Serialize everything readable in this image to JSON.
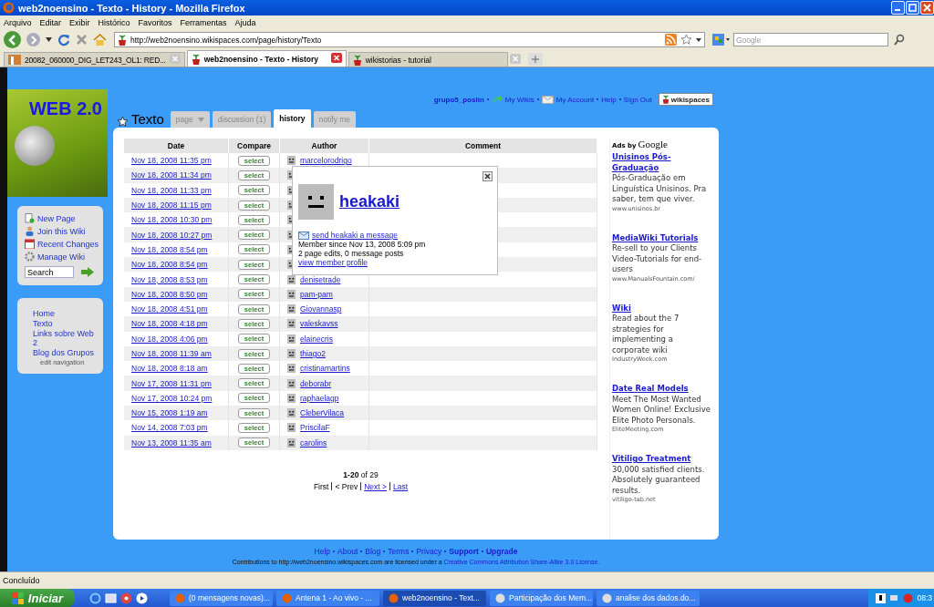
{
  "window": {
    "title": "web2noensino - Texto - History - Mozilla Firefox"
  },
  "menu": [
    "Arquivo",
    "Editar",
    "Exibir",
    "Histórico",
    "Favoritos",
    "Ferramentas",
    "Ajuda"
  ],
  "address": {
    "value": "http://web2noensino.wikispaces.com/page/history/Texto"
  },
  "search_engine": {
    "placeholder": "Google"
  },
  "browser_tabs": [
    {
      "label": "20082_060000_DIG_LET243_OL1: RED...",
      "selected": false
    },
    {
      "label": "web2noensino - Texto - History",
      "selected": true
    },
    {
      "label": "wikistorias - tutorial",
      "selected": false
    }
  ],
  "site": {
    "logo_text": "WEB 2.0",
    "user_links": [
      {
        "label": "grupo5_poslin",
        "bold": true
      },
      {
        "label": "My Wikis",
        "bold": false
      },
      {
        "label": "My Account",
        "bold": false
      },
      {
        "label": "Help",
        "bold": false
      },
      {
        "label": "Sign Out",
        "bold": false
      }
    ],
    "brand": "wikispaces"
  },
  "actions": [
    "New Page",
    "Join this Wiki",
    "Recent Changes",
    "Manage Wiki"
  ],
  "search": {
    "placeholder": "Search"
  },
  "navigation": {
    "items": [
      "Home",
      "Texto",
      "Links sobre Web 2",
      "Blog dos Grupos"
    ],
    "edit": "edit navigation"
  },
  "page": {
    "title": "Texto",
    "tabs": [
      {
        "label": "page",
        "selected": false
      },
      {
        "label": "discussion (1)",
        "selected": false
      },
      {
        "label": "history",
        "selected": true
      },
      {
        "label": "notify me",
        "selected": false
      }
    ]
  },
  "table": {
    "columns": [
      "Date",
      "Compare",
      "Author",
      "Comment"
    ],
    "rows": [
      {
        "date": "Nov 18, 2008 11:35 pm",
        "compare": "select",
        "author": "marcelorodrigo"
      },
      {
        "date": "Nov 18, 2008 11:34 pm",
        "compare": "select"
      },
      {
        "date": "Nov 18, 2008 11:33 pm",
        "compare": "select"
      },
      {
        "date": "Nov 18, 2008 11:15 pm",
        "compare": "select"
      },
      {
        "date": "Nov 18, 2008 10:30 pm",
        "compare": "select"
      },
      {
        "date": "Nov 18, 2008 10:27 pm",
        "compare": "select"
      },
      {
        "date": "Nov 18, 2008 8:54 pm",
        "compare": "select"
      },
      {
        "date": "Nov 18, 2008 8:54 pm",
        "compare": "select"
      },
      {
        "date": "Nov 18, 2008 8:53 pm",
        "compare": "select",
        "author": "denisetrade"
      },
      {
        "date": "Nov 18, 2008 8:50 pm",
        "compare": "select",
        "author": "pam-pam"
      },
      {
        "date": "Nov 18, 2008 4:51 pm",
        "compare": "select",
        "author": "Giovannasp"
      },
      {
        "date": "Nov 18, 2008 4:18 pm",
        "compare": "select",
        "author": "valeskavss"
      },
      {
        "date": "Nov 18, 2008 4:06 pm",
        "compare": "select",
        "author": "elainecris"
      },
      {
        "date": "Nov 18, 2008 11:39 am",
        "compare": "select",
        "author": "thiago2"
      },
      {
        "date": "Nov 18, 2008 8:18 am",
        "compare": "select",
        "author": "cristinamartins"
      },
      {
        "date": "Nov 17, 2008 11:31 pm",
        "compare": "select",
        "author": "deborabr"
      },
      {
        "date": "Nov 17, 2008 10:24 pm",
        "compare": "select",
        "author": "raphaelagp"
      },
      {
        "date": "Nov 15, 2008 1:19 am",
        "compare": "select",
        "author": "CleberVilaca"
      },
      {
        "date": "Nov 14, 2008 7:03 pm",
        "compare": "select",
        "author": "PriscilaF"
      },
      {
        "date": "Nov 13, 2008 11:35 am",
        "compare": "select",
        "author": "carolins"
      }
    ]
  },
  "popup": {
    "name": "heakaki",
    "message_link": "send heakaki a message",
    "member_since": "Member since Nov 13, 2008 5:09 pm",
    "stats": "2 page edits, 0 message posts",
    "profile_link": "view member profile"
  },
  "pagination": {
    "range": "1-20",
    "total": "of 29",
    "items": [
      {
        "label": "First",
        "link": false
      },
      {
        "label": "< Prev",
        "link": false
      },
      {
        "label": "Next >",
        "link": true
      },
      {
        "label": "Last",
        "link": true
      }
    ]
  },
  "ads": {
    "header": "Ads by",
    "brand": "Google",
    "items": [
      {
        "title": "Unisinos Pós-Graduação",
        "body": "Pós-Graduação em Linguística Unisinos. Pra saber, tem que viver.",
        "url": "www.unisinos.br"
      },
      {
        "title": "MediaWiki Tutorials",
        "body": "Re-sell to your Clients Video-Tutorials for end-users",
        "url": "www.ManualsFountain.com/"
      },
      {
        "title": "Wiki",
        "body": "Read about the 7 strategies for implementing a corporate wiki",
        "url": "IndustryWeek.com"
      },
      {
        "title": "Date Real Models",
        "body": "Meet The Most Wanted Women Online! Exclusive Elite Photo Personals.",
        "url": "EliteMeeting.com"
      },
      {
        "title": "Vitiligo Treatment",
        "body": "30,000 satisfied clients. Absolutely guaranteed results.",
        "url": "vitiligo-tab.net"
      }
    ]
  },
  "footer": {
    "links": [
      {
        "label": "Help",
        "bold": false
      },
      {
        "label": "About",
        "bold": false
      },
      {
        "label": "Blog",
        "bold": false
      },
      {
        "label": "Terms",
        "bold": false
      },
      {
        "label": "Privacy",
        "bold": false
      },
      {
        "label": "Support",
        "bold": true
      },
      {
        "label": "Upgrade",
        "bold": true
      }
    ],
    "license_text": "Contributions to http://web2noensino.wikispaces.com are licensed under a",
    "license_link": "Creative Commons Attribution Share-Alike 3.0 License."
  },
  "status_bar": "Concluído",
  "taskbar": {
    "start": "Iniciar",
    "tasks": [
      {
        "label": "(0 mensagens novas)...",
        "selected": false
      },
      {
        "label": "Antena 1 - Ao vivo - ...",
        "selected": false
      },
      {
        "label": "web2noensino - Text...",
        "selected": true
      },
      {
        "label": "Participação dos Mem...",
        "selected": false
      },
      {
        "label": "analise dos dados.do...",
        "selected": false
      }
    ],
    "clock": "08:3"
  }
}
